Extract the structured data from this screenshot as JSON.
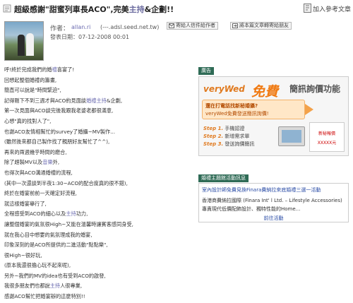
{
  "header": {
    "title_pre": "超級感謝\"甜蜜列車長ACO\",完美",
    "title_kw": "主持",
    "title_post": "&企劃!!",
    "bookmark_label": "加入參考文章"
  },
  "author": {
    "label": "作者：",
    "name": "allan.ri",
    "host": "(---.adsl.seed.net.tw)",
    "published": "發表日期：07-12-2008 00:01",
    "send_button": "寄給人信件給作者",
    "recommend_button": "將本篇文章轉寄給朋友"
  },
  "article": {
    "lines": [
      [
        {
          "t": "呼!終於完成我們的婚"
        },
        {
          "t": "禮",
          "k": true
        },
        {
          "t": "喜宴了!"
        }
      ],
      [
        {
          "t": "回想起整個婚禮的籌畫,"
        }
      ],
      [
        {
          "t": "簡直可以說是\"時間緊迫\","
        }
      ],
      [
        {
          "t": "記得剛下不到三週才與ACO約見面談"
        },
        {
          "t": "婚禮主持",
          "k": true
        },
        {
          "t": "&企劃,"
        }
      ],
      [
        {
          "t": "第一次見面與ACO談完後我跟我老婆老都很滿意,"
        }
      ],
      [
        {
          "t": "心想\"真的找對人了\","
        }
      ],
      [
        {
          "t": "也謝ACO友情相幫忙的survey了婚攝~MV製作..."
        }
      ],
      [
        {
          "t": "(雖然後來都自己製作找了親朋好友幫忙了^^),"
        }
      ],
      [
        {
          "t": "再來的兩週幾乎時間的磨合,"
        }
      ],
      [
        {
          "t": "除了趕製MV以及"
        },
        {
          "t": "音樂",
          "k": true
        },
        {
          "t": "外,"
        }
      ],
      [
        {
          "t": "也得次與ACO溝通婚禮的流程,"
        }
      ],
      [
        {
          "t": "(其中一次還談到半夜1:30~ACO的配合度真的很不錯),"
        }
      ],
      [
        {
          "t": "終於在婚宴前前一天確定好流程,"
        }
      ],
      [
        {
          "t": "就這樣婚宴舉行了,"
        }
      ],
      [
        {
          "t": "全程感受到ACO的細心以及"
        },
        {
          "t": "主持",
          "k": true
        },
        {
          "t": "功力,"
        }
      ],
      [
        {
          "t": "讓整個婚宴的氣氛很High~又能在溫馨時讓賓客感同身受,"
        }
      ],
      [
        {
          "t": "就在我心目中想要的氣氛理成我的婚宴,"
        }
      ],
      [
        {
          "t": "印象深刻的是ACO所提供的二進活動\"點點樂\","
        }
      ],
      [
        {
          "t": "很High~很好玩,"
        }
      ],
      [
        {
          "t": "(原本我還很擔心玩不起來呢),"
        }
      ],
      [
        {
          "t": "另外~我們的MV的idea也有受到ACO的啟發,"
        }
      ],
      [
        {
          "t": "我很多朋友們也都說"
        },
        {
          "t": "主持",
          "k": true
        },
        {
          "t": "人很專業,"
        }
      ],
      [
        {
          "t": "感謝ACO幫忙把婚宴辦的這麼特別!!"
        }
      ]
    ]
  },
  "ad": {
    "label": "廣告",
    "brand": "veryWed",
    "free": "免費",
    "headline": "簡訊詢價功能",
    "q1": "還在打電話找新秘婚攝?",
    "q2": "veryWed免費發送簡訊詢價!",
    "steps": [
      {
        "num": "Step 1.",
        "text": "手機認證"
      },
      {
        "num": "Step 2.",
        "text": "新增需求單"
      },
      {
        "num": "Step 3.",
        "text": "發送詢價簡訊"
      }
    ],
    "price_title": "新秘報價",
    "price_value": "XXXXX元"
  },
  "activity": {
    "label": "婚禮主題館活動訊息",
    "link": "室內設計師免費見換Finara費納拉來底婚禮三選一活動",
    "desc_line1": "香港商費納拉國際 (Finara Int' l Ltd. – Lifestyle Accessories)",
    "desc_line2": "專責現代低價配飾設計、獨特性能的Home...",
    "more": "前往活動"
  },
  "colors": {
    "accent_green": "#2f6b56",
    "keyword": "#6b6bb0",
    "ad_orange": "#e07a1f",
    "link_blue": "#2a4ca6"
  }
}
